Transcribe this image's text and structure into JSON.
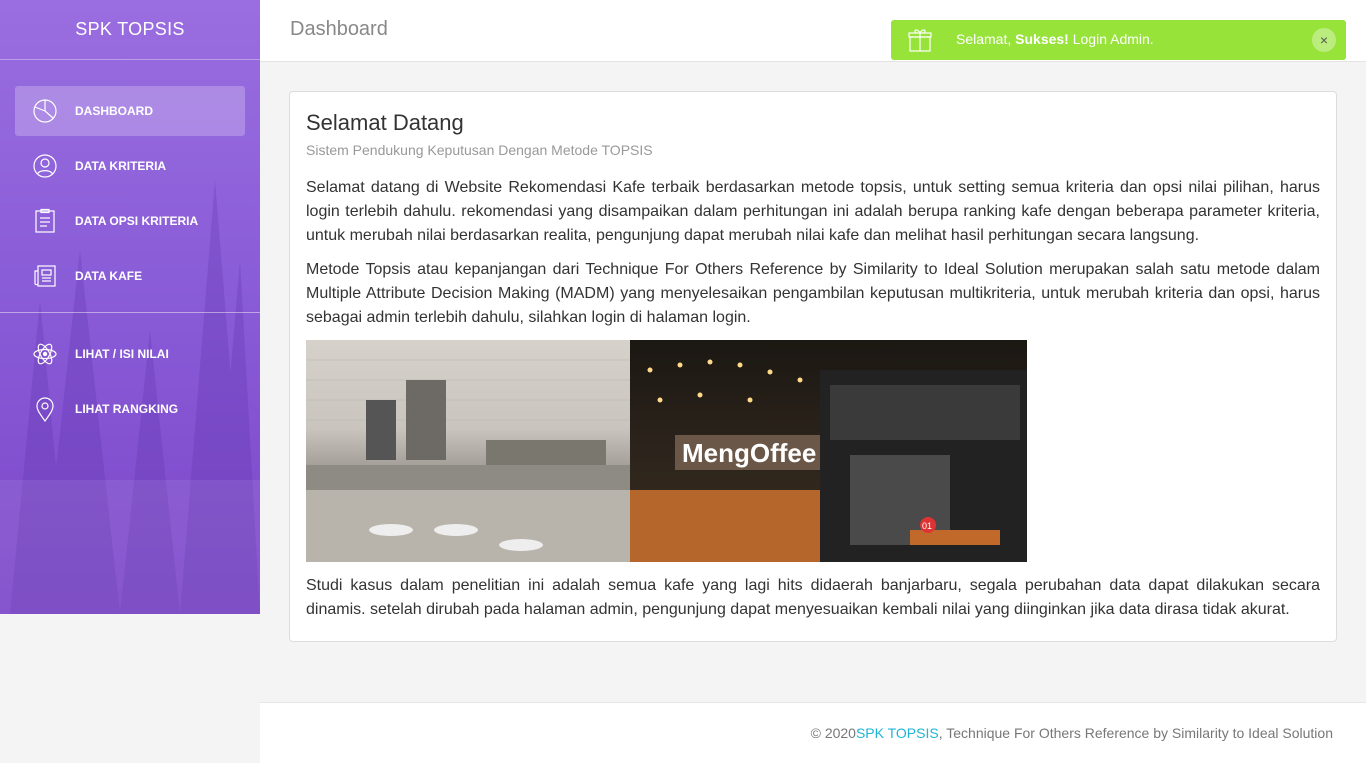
{
  "sidebar": {
    "logo": "SPK TOPSIS",
    "items": [
      {
        "label": "DASHBOARD",
        "icon": "pie-chart-icon",
        "active": true
      },
      {
        "label": "DATA KRITERIA",
        "icon": "user-icon"
      },
      {
        "label": "DATA OPSI KRITERIA",
        "icon": "clipboard-icon"
      },
      {
        "label": "DATA KAFE",
        "icon": "news-icon"
      }
    ],
    "items2": [
      {
        "label": "LIHAT / ISI NILAI",
        "icon": "atom-icon"
      },
      {
        "label": "LIHAT RANGKING",
        "icon": "location-pin-icon"
      }
    ]
  },
  "header": {
    "title": "Dashboard"
  },
  "notification": {
    "prefix": "Selamat, ",
    "bold": "Sukses!",
    "suffix": " Login Admin.",
    "close": "×",
    "color": "#97e33a"
  },
  "card": {
    "title": "Selamat Datang",
    "subtitle": "Sistem Pendukung Keputusan Dengan Metode TOPSIS",
    "paragraph1": "Selamat datang di Website Rekomendasi Kafe terbaik berdasarkan metode topsis, untuk setting semua kriteria dan opsi nilai pilihan, harus login terlebih dahulu. rekomendasi yang disampaikan dalam perhitungan ini adalah berupa ranking kafe dengan beberapa parameter kriteria, untuk merubah nilai berdasarkan realita, pengunjung dapat merubah nilai kafe dan melihat hasil perhitungan secara langsung.",
    "paragraph2": "Metode Topsis atau kepanjangan dari Technique For Others Reference by Similarity to Ideal Solution merupakan salah satu metode dalam Multiple Attribute Decision Making (MADM) yang menyelesaikan pengambilan keputusan multikriteria, untuk merubah kriteria dan opsi, harus sebagai admin terlebih dahulu, silahkan login di halaman login.",
    "image_sign": "MengOffee",
    "image_table_number": "01",
    "paragraph3": "Studi kasus dalam penelitian ini adalah semua kafe yang lagi hits didaerah banjarbaru, segala perubahan data dapat dilakukan secara dinamis. setelah dirubah pada halaman admin, pengunjung dapat menyesuaikan kembali nilai yang diinginkan jika data dirasa tidak akurat."
  },
  "footer": {
    "prefix": "© 2020 ",
    "brand": "SPK TOPSIS",
    "suffix": ", Technique For Others Reference by Similarity to Ideal Solution",
    "brand_color": "#1fb5d6"
  }
}
